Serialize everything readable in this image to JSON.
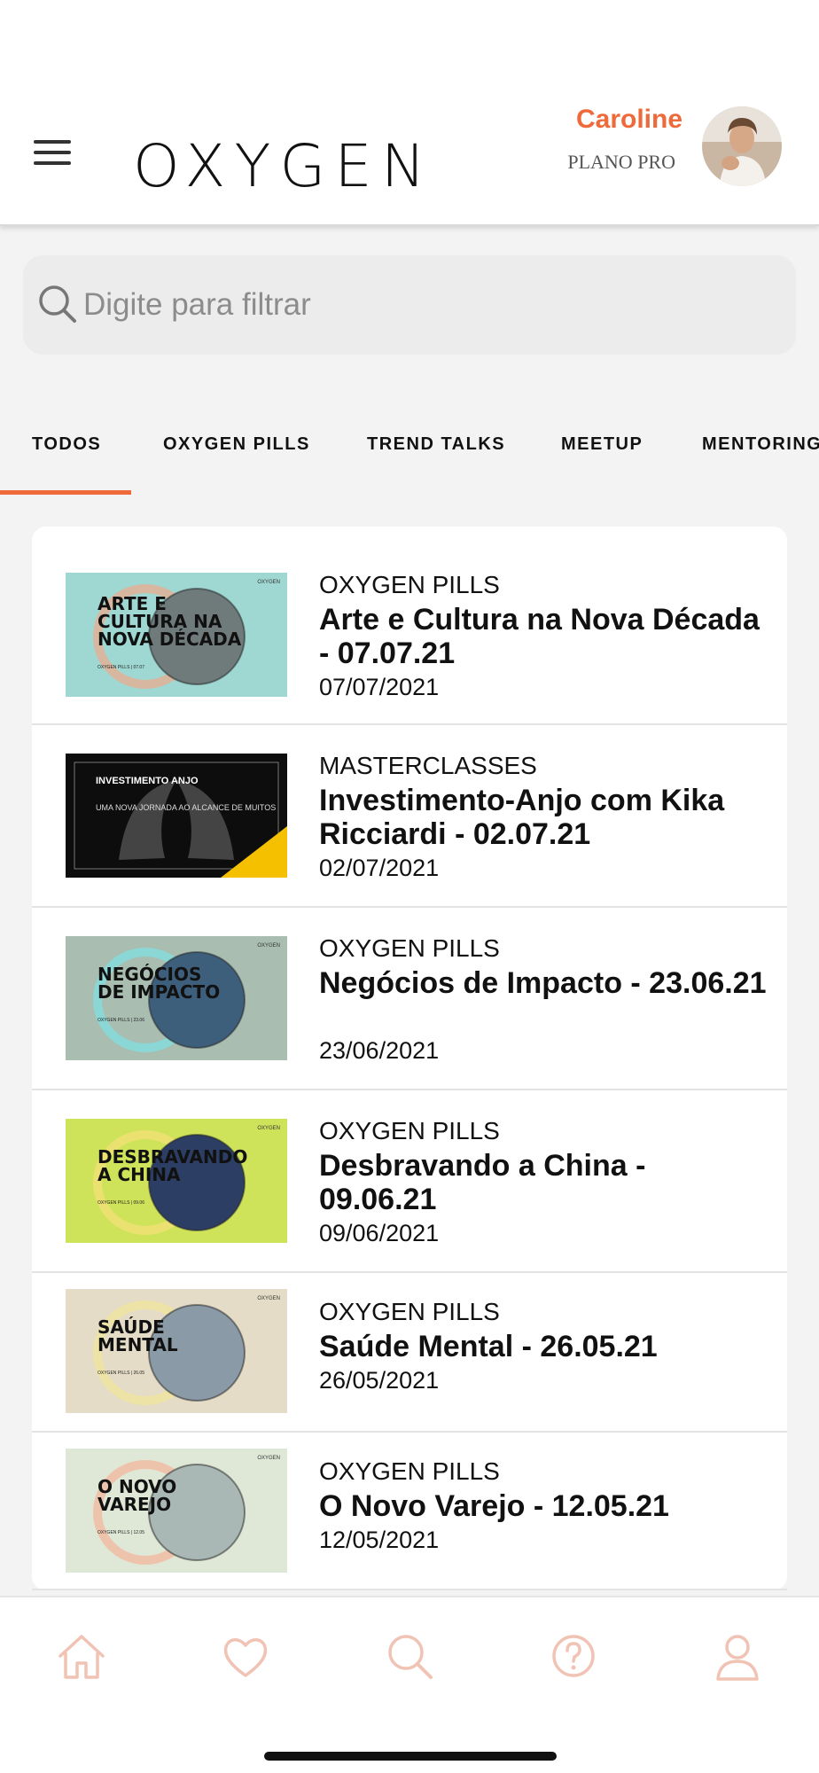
{
  "header": {
    "logo_text": "OXYGEN",
    "user_name": "Caroline",
    "user_plan": "PLANO PRO"
  },
  "search": {
    "placeholder": "Digite para filtrar"
  },
  "tabs": [
    {
      "label": "TODOS",
      "active": true
    },
    {
      "label": "OXYGEN PILLS",
      "active": false
    },
    {
      "label": "TREND TALKS",
      "active": false
    },
    {
      "label": "MEETUP",
      "active": false
    },
    {
      "label": "MENTORING",
      "active": false
    }
  ],
  "items": [
    {
      "category": "OXYGEN PILLS",
      "title": "Arte e Cultura na Nova Década - 07.07.21",
      "date": "07/07/2021",
      "thumb": {
        "lines": [
          "ARTE E",
          "CULTURA NA",
          "NOVA DÉCADA"
        ],
        "sub": "OXYGEN PILLS | 07.07",
        "bg": "#9fd8d3",
        "glow": "#f0a98a",
        "circle": "#6f7a7b",
        "brand": "OXYGEN"
      }
    },
    {
      "category": "MASTERCLASSES",
      "title": "Investimento-Anjo com Kika Ricciardi - 02.07.21",
      "date": "02/07/2021",
      "thumb": {
        "lines": [
          "INVESTIMENTO ANJO"
        ],
        "sub": "UMA NOVA JORNADA AO ALCANCE DE MUITOS",
        "bg": "#0d0d0d",
        "accent": "#f5c000"
      }
    },
    {
      "category": "OXYGEN PILLS",
      "title": "Negócios de Impacto - 23.06.21",
      "date": "23/06/2021",
      "thumb": {
        "lines": [
          "NEGÓCIOS",
          "DE IMPACTO"
        ],
        "sub": "OXYGEN PILLS | 23.06",
        "bg": "#a9bdb1",
        "glow": "#7fe3e6",
        "circle": "#3e5f7c",
        "brand": "OXYGEN"
      }
    },
    {
      "category": "OXYGEN PILLS",
      "title": "Desbravando a China - 09.06.21",
      "date": "09/06/2021",
      "thumb": {
        "lines": [
          "DESBRAVANDO",
          "A CHINA"
        ],
        "sub": "OXYGEN PILLS | 09.06",
        "bg": "#cfe35a",
        "glow": "#f5e07a",
        "circle": "#2c3e63",
        "brand": "OXYGEN"
      }
    },
    {
      "category": "OXYGEN PILLS",
      "title": "Saúde Mental - 26.05.21",
      "date": "26/05/2021",
      "thumb": {
        "lines": [
          "SAÚDE",
          "MENTAL"
        ],
        "sub": "OXYGEN PILLS | 26.05",
        "bg": "#e4dcc6",
        "glow": "#f1e59a",
        "circle": "#8a9aa6",
        "brand": "OXYGEN"
      }
    },
    {
      "category": "OXYGEN PILLS",
      "title": "O Novo Varejo - 12.05.21",
      "date": "12/05/2021",
      "thumb": {
        "lines": [
          "O NOVO",
          "VAREJO"
        ],
        "sub": "OXYGEN PILLS | 12.05",
        "bg": "#dfe8d6",
        "glow": "#f3b39a",
        "circle": "#a9b8b5",
        "brand": "OXYGEN"
      }
    }
  ],
  "bottom_nav": [
    {
      "icon": "home-icon",
      "active": true
    },
    {
      "icon": "heart-icon",
      "active": false
    },
    {
      "icon": "search-icon",
      "active": false
    },
    {
      "icon": "help-icon",
      "active": false
    },
    {
      "icon": "profile-icon",
      "active": false
    }
  ],
  "colors": {
    "accent": "#ef6a3a",
    "nav_icon": "#f0c3b4"
  }
}
